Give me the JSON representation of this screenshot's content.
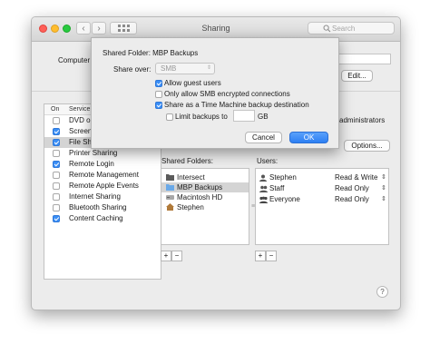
{
  "window": {
    "title": "Sharing",
    "search_placeholder": "Search"
  },
  "background": {
    "computer_label": "Computer",
    "edit_label": "Edit...",
    "administrators_text": "administrators",
    "options_label": "Options...",
    "services_header_on": "On",
    "services_header_service": "Service",
    "services": [
      {
        "label": "DVD or",
        "on": false
      },
      {
        "label": "Screen",
        "on": true
      },
      {
        "label": "File Sha",
        "on": true
      },
      {
        "label": "Printer Sharing",
        "on": false
      },
      {
        "label": "Remote Login",
        "on": true
      },
      {
        "label": "Remote Management",
        "on": false
      },
      {
        "label": "Remote Apple Events",
        "on": false
      },
      {
        "label": "Internet Sharing",
        "on": false
      },
      {
        "label": "Bluetooth Sharing",
        "on": false
      },
      {
        "label": "Content Caching",
        "on": true
      }
    ],
    "shared_folders_title": "Shared Folders:",
    "shared_folders": [
      {
        "label": "Intersect",
        "icon": "folder-dark-icon"
      },
      {
        "label": "MBP Backups",
        "icon": "folder-blue-icon"
      },
      {
        "label": "Macintosh HD",
        "icon": "hard-drive-icon"
      },
      {
        "label": "Stephen",
        "icon": "home-icon"
      }
    ],
    "users_title": "Users:",
    "users": [
      {
        "name": "Stephen",
        "access": "Read & Write"
      },
      {
        "name": "Staff",
        "access": "Read Only"
      },
      {
        "name": "Everyone",
        "access": "Read Only"
      }
    ],
    "plus": "+",
    "minus": "−",
    "help": "?"
  },
  "dialog": {
    "title": "Shared Folder: MBP Backups",
    "share_over_label": "Share over:",
    "share_over_value": "SMB",
    "allow_guest": "Allow guest users",
    "smb_encrypted": "Only allow SMB encrypted connections",
    "time_machine": "Share as a Time Machine backup destination",
    "limit_backups": "Limit backups to",
    "limit_value": "",
    "gb": "GB",
    "cancel": "Cancel",
    "ok": "OK",
    "checks": {
      "allow_guest": true,
      "smb_encrypted": false,
      "time_machine": true,
      "limit_backups": false
    }
  },
  "colors": {
    "accent": "#3a8ef6",
    "selection": "#d4d4d4"
  }
}
